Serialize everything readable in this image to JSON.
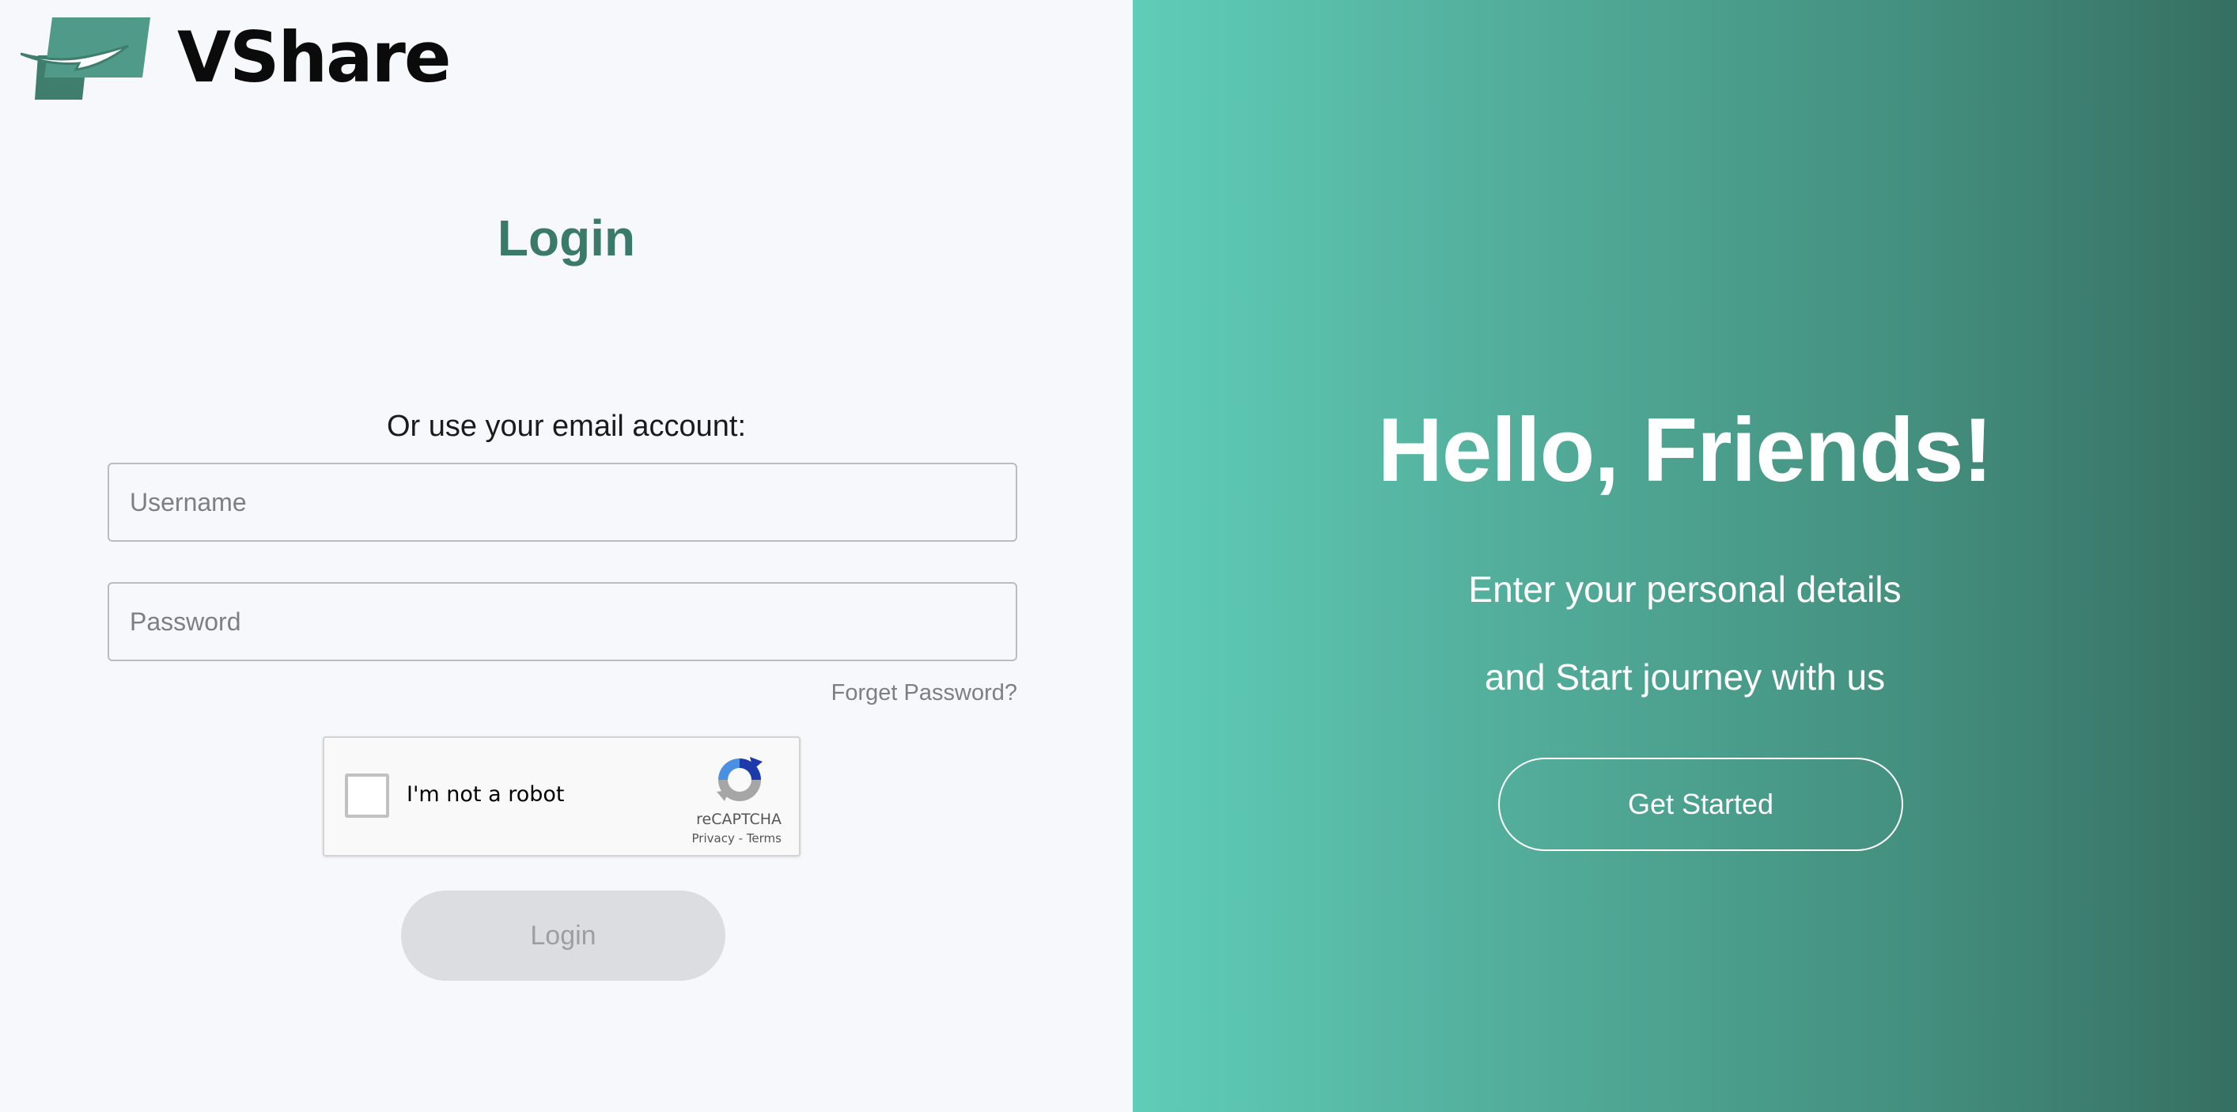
{
  "brand": {
    "name": "VShare",
    "colors": {
      "primary": "#3a7a6a",
      "accent_light": "#5fcdb8",
      "accent_dark": "#366f62"
    }
  },
  "login": {
    "title": "Login",
    "email_hint": "Or use your email account:",
    "username_placeholder": "Username",
    "password_placeholder": "Password",
    "username_value": "",
    "password_value": "",
    "forget_password": "Forget Password?",
    "submit_label": "Login"
  },
  "captcha": {
    "label": "I'm not a robot",
    "brand": "reCAPTCHA",
    "privacy": "Privacy",
    "separator": "-",
    "terms": "Terms",
    "checked": false
  },
  "welcome": {
    "heading": "Hello, Friends!",
    "line1": "Enter your personal details",
    "line2": "and Start journey with us",
    "cta_label": "Get Started"
  }
}
